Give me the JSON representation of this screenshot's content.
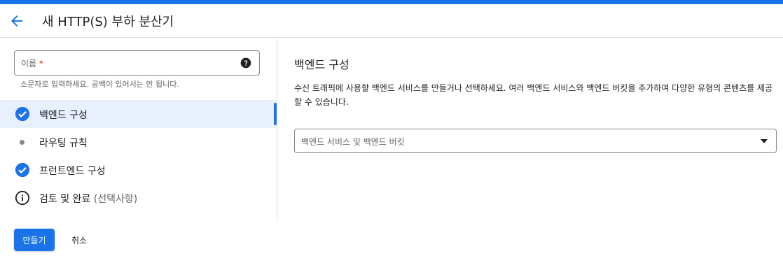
{
  "colors": {
    "accent": "#1a73e8",
    "border": "#dadce0",
    "active_bg": "#e8f0fe",
    "required": "#d93025"
  },
  "header": {
    "title": "새 HTTP(S) 부하 분산기",
    "back_icon": "arrow-back-icon"
  },
  "name_field": {
    "placeholder": "이름",
    "required_mark": "*",
    "help_icon": "help-icon",
    "hint": "소문자로 입력하세요. 공백이 있어서는 안 됩니다."
  },
  "steps": [
    {
      "label": "백엔드 구성",
      "status": "complete",
      "icon": "check-circle-icon"
    },
    {
      "label": "라우팅 규칙",
      "status": "pending",
      "icon": "dot-icon"
    },
    {
      "label": "프런트엔드 구성",
      "status": "complete",
      "icon": "check-circle-icon"
    },
    {
      "label": "검토 및 완료",
      "optional": "(선택사항)",
      "status": "info",
      "icon": "info-icon"
    }
  ],
  "footer": {
    "create_label": "만들기",
    "cancel_label": "취소"
  },
  "backend": {
    "title": "백엔드 구성",
    "description": "수신 트래픽에 사용할 백엔드 서비스를 만들거나 선택하세요. 여러 백엔드 서비스와 백엔드 버킷을 추가하여 다양한 유형의 콘텐츠를 제공할 수 있습니다.",
    "select_label": "백엔드 서비스 및 백엔드 버킷"
  }
}
